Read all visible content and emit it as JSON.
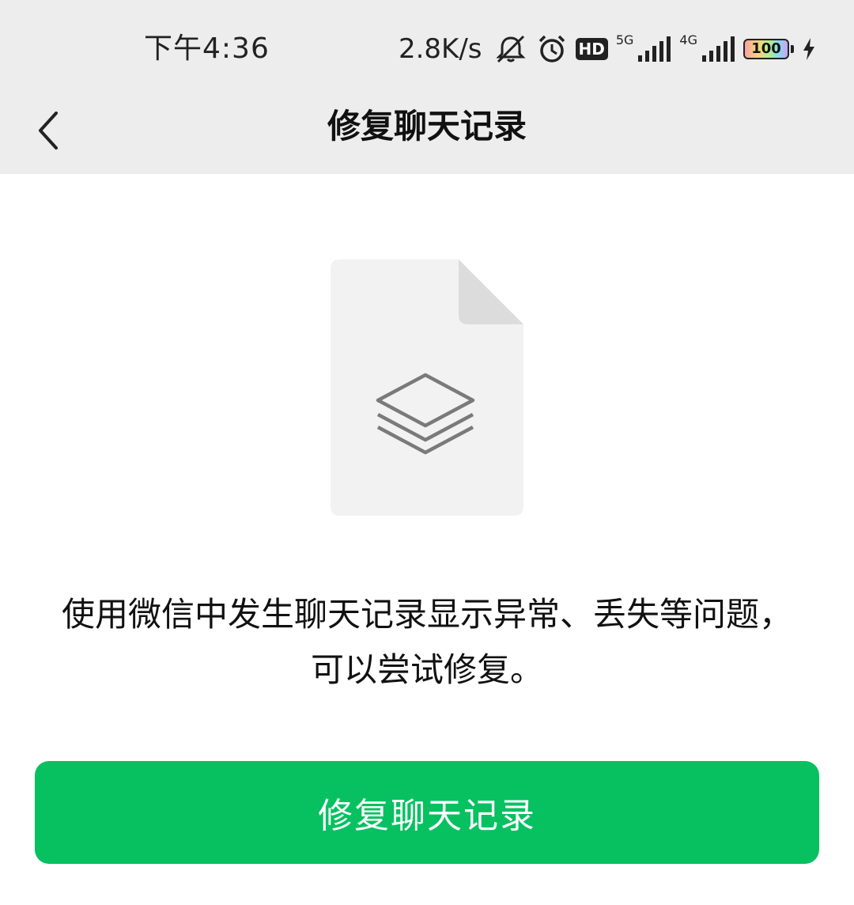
{
  "status_bar": {
    "time": "下午4:36",
    "net_speed": "2.8K/s",
    "hd_label": "HD",
    "network_5g_label": "5G",
    "network_4g_label": "4G",
    "battery_level": "100",
    "icons": [
      "mute-icon",
      "alarm-icon",
      "hd-icon",
      "signal-5g-icon",
      "signal-4g-icon",
      "battery-icon",
      "charging-icon"
    ]
  },
  "nav": {
    "title": "修复聊天记录",
    "back_icon": "chevron-left-icon"
  },
  "illustration": {
    "icon": "layers-icon"
  },
  "content": {
    "description": "使用微信中发生聊天记录显示异常、丢失等问题，可以尝试修复。"
  },
  "action": {
    "button_label": "修复聊天记录",
    "button_color": "#07c160"
  },
  "colors": {
    "header_bg": "#ededed",
    "page_bg": "#ffffff",
    "accent": "#07c160"
  }
}
